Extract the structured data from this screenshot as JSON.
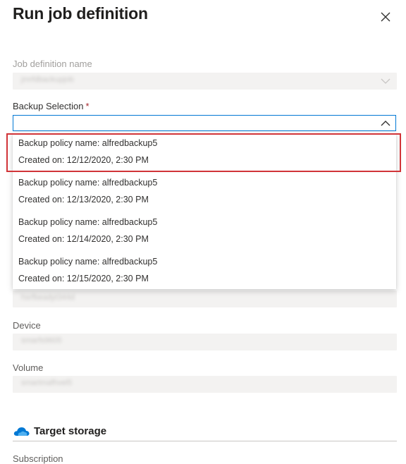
{
  "panel": {
    "title": "Run job definition",
    "close_icon": "close-icon"
  },
  "fields": {
    "job_definition_name": {
      "label": "Job definition name",
      "value": "jmrfdbackupjob"
    },
    "backup_selection": {
      "label": "Backup Selection",
      "required_mark": "*",
      "value": ""
    },
    "hidden_field": {
      "value": "hsrfbeadyt344d"
    },
    "device": {
      "label": "Device",
      "value": "smarfs9605"
    },
    "volume": {
      "label": "Volume",
      "value": "smartmafhvel5"
    }
  },
  "backup_options": [
    {
      "policy": "Backup policy name: alfredbackup5",
      "created": "Created on: 12/12/2020, 2:30 PM"
    },
    {
      "policy": "Backup policy name: alfredbackup5",
      "created": "Created on: 12/13/2020, 2:30 PM"
    },
    {
      "policy": "Backup policy name: alfredbackup5",
      "created": "Created on: 12/14/2020, 2:30 PM"
    },
    {
      "policy": "Backup policy name: alfredbackup5",
      "created": "Created on: 12/15/2020, 2:30 PM"
    }
  ],
  "target_storage": {
    "heading": "Target storage",
    "icon": "cloud-icon",
    "subscription_label": "Subscription"
  },
  "colors": {
    "accent": "#0078d4",
    "highlight": "#d13438",
    "required": "#a4262c",
    "disabled_bg": "#f3f2f1"
  }
}
